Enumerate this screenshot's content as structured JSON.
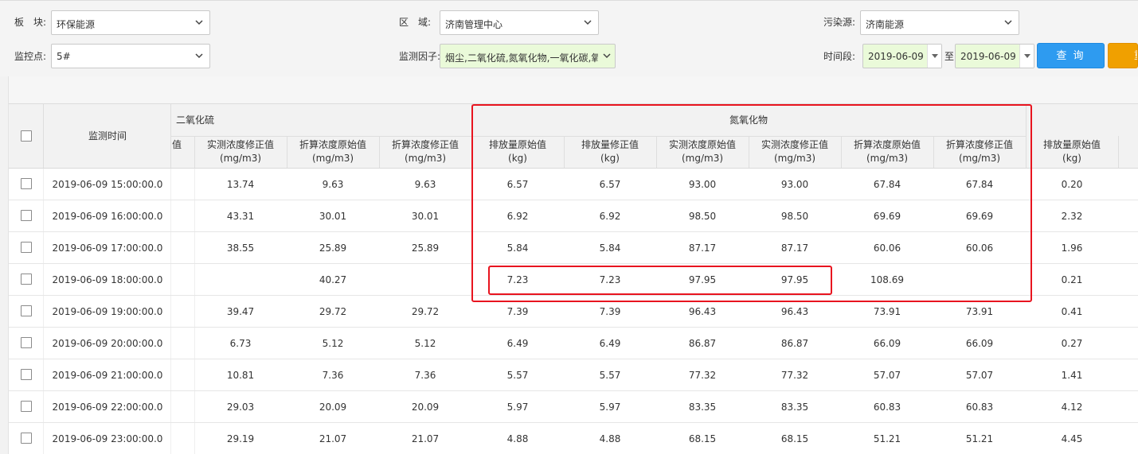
{
  "filters": {
    "sector_label": "板　块:",
    "sector_value": "环保能源",
    "region_label": "区　域:",
    "region_value": "济南管理中心",
    "source_label": "污染源:",
    "source_value": "济南能源",
    "point_label": "监控点:",
    "point_value": "5#",
    "factor_label": "监测因子:",
    "factor_value": "烟尘,二氧化硫,氮氧化物,一氧化碳,氧",
    "period_label": "时间段:",
    "date_from": "2019-06-09",
    "date_to_label": "至",
    "date_to": "2019-06-09",
    "query_button": "查 询",
    "reset_button": "重"
  },
  "table": {
    "time_header": "监测时间",
    "group_so2": "二氧化硫",
    "group_nox": "氮氧化物",
    "cut_col": "值",
    "columns": [
      {
        "name": "实测浓度修正值",
        "unit": "(mg/m3)"
      },
      {
        "name": "折算浓度原始值",
        "unit": "(mg/m3)"
      },
      {
        "name": "折算浓度修正值",
        "unit": "(mg/m3)"
      },
      {
        "name": "排放量原始值",
        "unit": "(kg)"
      },
      {
        "name": "排放量修正值",
        "unit": "(kg)"
      },
      {
        "name": "实测浓度原始值",
        "unit": "(mg/m3)"
      },
      {
        "name": "实测浓度修正值",
        "unit": "(mg/m3)"
      },
      {
        "name": "折算浓度原始值",
        "unit": "(mg/m3)"
      },
      {
        "name": "折算浓度修正值",
        "unit": "(mg/m3)"
      },
      {
        "name": "排放量原始值",
        "unit": "(kg)"
      }
    ],
    "rows": [
      {
        "time": "2019-06-09 15:00:00.0",
        "v": [
          "13.74",
          "9.63",
          "9.63",
          "6.57",
          "6.57",
          "93.00",
          "93.00",
          "67.84",
          "67.84",
          "0.20"
        ]
      },
      {
        "time": "2019-06-09 16:00:00.0",
        "v": [
          "43.31",
          "30.01",
          "30.01",
          "6.92",
          "6.92",
          "98.50",
          "98.50",
          "69.69",
          "69.69",
          "2.32"
        ]
      },
      {
        "time": "2019-06-09 17:00:00.0",
        "v": [
          "38.55",
          "25.89",
          "25.89",
          "5.84",
          "5.84",
          "87.17",
          "87.17",
          "60.06",
          "60.06",
          "1.96"
        ]
      },
      {
        "time": "2019-06-09 18:00:00.0",
        "v": [
          "",
          "40.27",
          "",
          "7.23",
          "7.23",
          "97.95",
          "97.95",
          "108.69",
          "",
          "0.21"
        ]
      },
      {
        "time": "2019-06-09 19:00:00.0",
        "v": [
          "39.47",
          "29.72",
          "29.72",
          "7.39",
          "7.39",
          "96.43",
          "96.43",
          "73.91",
          "73.91",
          "0.41"
        ]
      },
      {
        "time": "2019-06-09 20:00:00.0",
        "v": [
          "6.73",
          "5.12",
          "5.12",
          "6.49",
          "6.49",
          "86.87",
          "86.87",
          "66.09",
          "66.09",
          "0.27"
        ]
      },
      {
        "time": "2019-06-09 21:00:00.0",
        "v": [
          "10.81",
          "7.36",
          "7.36",
          "5.57",
          "5.57",
          "77.32",
          "77.32",
          "57.07",
          "57.07",
          "1.41"
        ]
      },
      {
        "time": "2019-06-09 22:00:00.0",
        "v": [
          "29.03",
          "20.09",
          "20.09",
          "5.97",
          "5.97",
          "83.35",
          "83.35",
          "60.83",
          "60.83",
          "4.12"
        ]
      },
      {
        "time": "2019-06-09 23:00:00.0",
        "v": [
          "29.19",
          "21.07",
          "21.07",
          "4.88",
          "4.88",
          "68.15",
          "68.15",
          "51.21",
          "51.21",
          "4.45"
        ]
      }
    ]
  },
  "colors": {
    "query_button": "#2e9bf0",
    "reset_button": "#f0a000",
    "highlight_box": "#e8141f",
    "selected_field": "#eafad9"
  }
}
